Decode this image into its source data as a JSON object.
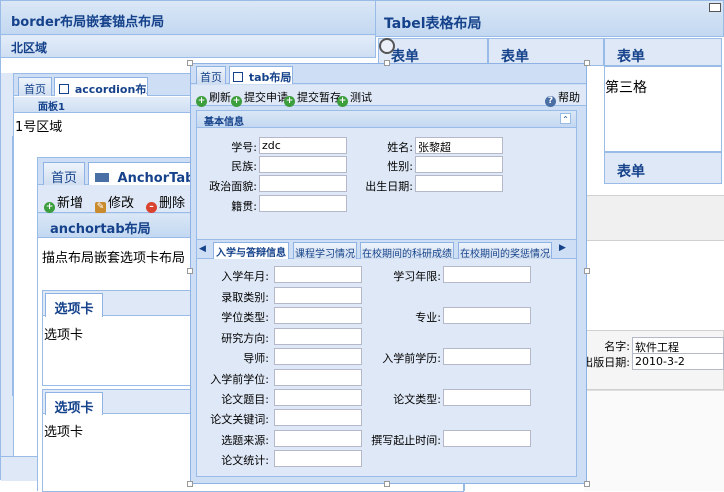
{
  "border_win": {
    "title": "border布局嵌套锚点布局",
    "north_region": "北区域",
    "tabs": [
      "首页",
      "accordion布局"
    ],
    "panel1": "面板1",
    "region1": "1号区域"
  },
  "anchor_win": {
    "tabs": [
      "首页",
      "AnchorTab页"
    ],
    "toolbar": [
      "新增",
      "修改",
      "删除"
    ],
    "header": "anchortab布局",
    "body_text": "描点布局嵌套选项卡布局",
    "card1_title": "选项卡",
    "card1_body": "选项卡",
    "card2_title": "选项卡",
    "card2_body": "选项卡"
  },
  "table_win": {
    "title": "Tabel表格布局",
    "cells": [
      "表单",
      "表单",
      "表单",
      "第三格",
      "表单"
    ]
  },
  "right_form": {
    "name_label": "名字:",
    "name_value": "软件工程",
    "date_label": "出版日期:",
    "date_value": "2010-3-2"
  },
  "tab_win": {
    "tabs": [
      "首页",
      "tab布局"
    ],
    "toolbar": [
      "刷新",
      "提交申请",
      "提交暂存",
      "测试"
    ],
    "help": "帮助",
    "basic_title": "基本信息",
    "basic": {
      "student_no_label": "学号:",
      "student_no_value": "zdc",
      "name_label": "姓名:",
      "name_value": "张黎超",
      "ethnicity_label": "民族:",
      "gender_label": "性别:",
      "politics_label": "政治面貌:",
      "birth_label": "出生日期:",
      "origin_label": "籍贯:"
    },
    "inner_tabs": [
      "入学与答辩信息",
      "课程学习情况",
      "在校期间的科研成绩",
      "在校期间的奖惩情况"
    ],
    "form": {
      "enroll_date": "入学年月:",
      "study_years": "学习年限:",
      "admission_type": "录取类别:",
      "degree_type": "学位类型:",
      "major": "专业:",
      "research": "研究方向:",
      "tutor": "导师:",
      "prior_edu": "入学前学历:",
      "prior_degree": "入学前学位:",
      "thesis_title": "论文题目:",
      "thesis_type": "论文类型:",
      "keywords": "论文关键词:",
      "topic_source": "选题来源:",
      "write_time": "撰写起止时间:",
      "thesis_stats": "论文统计:"
    }
  },
  "colors": {
    "accent": "#15428b",
    "border": "#99bbe8",
    "tab_bg": "#cedff5"
  }
}
